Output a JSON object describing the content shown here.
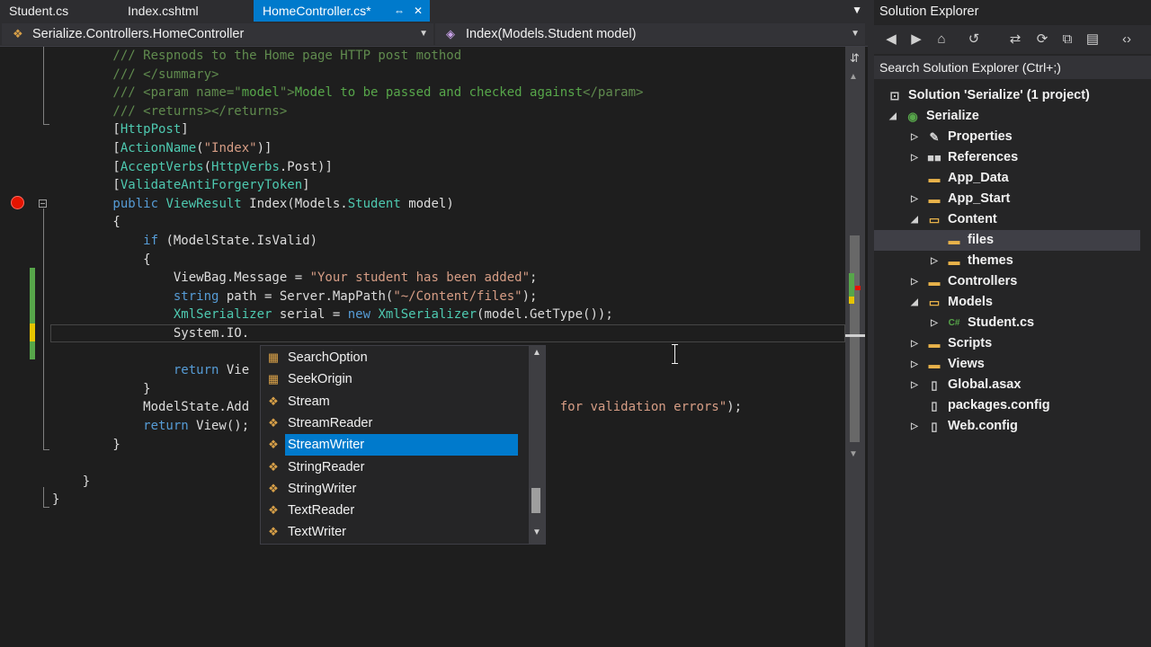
{
  "tabs": [
    {
      "label": "Student.cs"
    },
    {
      "label": "Index.cshtml"
    },
    {
      "label": "HomeController.cs*",
      "pin": "⇔",
      "close": "✕",
      "active": true
    }
  ],
  "navigation": {
    "type_dropdown": "Serialize.Controllers.HomeController",
    "member_dropdown": "Index(Models.Student model)"
  },
  "code_lines": [
    [
      {
        "c": "cmg",
        "t": "        /// Respnods to the Home page HTTP post mothod"
      }
    ],
    [
      {
        "c": "cmg",
        "t": "        /// </summary>"
      }
    ],
    [
      {
        "c": "cmg",
        "t": "        /// <param name=\""
      },
      {
        "c": "cm",
        "t": "model"
      },
      {
        "c": "cmg",
        "t": "\">"
      },
      {
        "c": "cm",
        "t": "Model to be passed and checked against"
      },
      {
        "c": "cmg",
        "t": "</param>"
      }
    ],
    [
      {
        "c": "cmg",
        "t": "        /// <returns></returns>"
      }
    ],
    [
      {
        "c": "pl",
        "t": "        ["
      },
      {
        "c": "ty",
        "t": "HttpPost"
      },
      {
        "c": "pl",
        "t": "]"
      }
    ],
    [
      {
        "c": "pl",
        "t": "        ["
      },
      {
        "c": "ty",
        "t": "ActionName"
      },
      {
        "c": "pl",
        "t": "("
      },
      {
        "c": "st",
        "t": "\"Index\""
      },
      {
        "c": "pl",
        "t": ")]"
      }
    ],
    [
      {
        "c": "pl",
        "t": "        ["
      },
      {
        "c": "ty",
        "t": "AcceptVerbs"
      },
      {
        "c": "pl",
        "t": "("
      },
      {
        "c": "ty",
        "t": "HttpVerbs"
      },
      {
        "c": "pl",
        "t": ".Post)]"
      }
    ],
    [
      {
        "c": "pl",
        "t": "        ["
      },
      {
        "c": "ty",
        "t": "ValidateAntiForgeryToken"
      },
      {
        "c": "pl",
        "t": "]"
      }
    ],
    [
      {
        "c": "kw",
        "t": "        public "
      },
      {
        "c": "ty",
        "t": "ViewResult"
      },
      {
        "c": "pl",
        "t": " Index(Models."
      },
      {
        "c": "ty",
        "t": "Student"
      },
      {
        "c": "pl",
        "t": " model)"
      }
    ],
    [
      {
        "c": "pl",
        "t": "        {"
      }
    ],
    [
      {
        "c": "kw",
        "t": "            if"
      },
      {
        "c": "pl",
        "t": " (ModelState.IsValid)"
      }
    ],
    [
      {
        "c": "pl",
        "t": "            {"
      }
    ],
    [
      {
        "c": "pl",
        "t": "                ViewBag.Message = "
      },
      {
        "c": "st",
        "t": "\"Your student has been added\""
      },
      {
        "c": "pl",
        "t": ";"
      }
    ],
    [
      {
        "c": "kw",
        "t": "                string"
      },
      {
        "c": "pl",
        "t": " path = Server.MapPath("
      },
      {
        "c": "st",
        "t": "\"~/Content/files\""
      },
      {
        "c": "pl",
        "t": ");"
      }
    ],
    [
      {
        "c": "ty",
        "t": "                XmlSerializer"
      },
      {
        "c": "pl",
        "t": " serial = "
      },
      {
        "c": "kw",
        "t": "new "
      },
      {
        "c": "ty",
        "t": "XmlSerializer"
      },
      {
        "c": "pl",
        "t": "(model.GetType());"
      }
    ],
    [
      {
        "c": "pl",
        "t": "                System.IO."
      }
    ],
    [
      {
        "c": "pl",
        "t": ""
      }
    ],
    [
      {
        "c": "kw",
        "t": "                return"
      },
      {
        "c": "pl",
        "t": " Vie"
      }
    ],
    [
      {
        "c": "pl",
        "t": "            }"
      }
    ],
    [
      {
        "c": "pl",
        "t": "            ModelState.Add"
      },
      {
        "c": "pl",
        "t": "                                         "
      },
      {
        "c": "st",
        "t": "for validation errors\""
      },
      {
        "c": "pl",
        "t": ");"
      }
    ],
    [
      {
        "c": "kw",
        "t": "            return"
      },
      {
        "c": "pl",
        "t": " View();"
      }
    ],
    [
      {
        "c": "pl",
        "t": "        }"
      }
    ],
    [
      {
        "c": "pl",
        "t": ""
      }
    ],
    [
      {
        "c": "pl",
        "t": "    }"
      }
    ],
    [
      {
        "c": "pl",
        "t": "}"
      }
    ]
  ],
  "intellisense": {
    "items": [
      {
        "label": "SearchOption",
        "icon": "enum-icon",
        "glyph": "▦"
      },
      {
        "label": "SeekOrigin",
        "icon": "enum-icon",
        "glyph": "▦"
      },
      {
        "label": "Stream",
        "icon": "class-icon",
        "glyph": "❖"
      },
      {
        "label": "StreamReader",
        "icon": "class-icon",
        "glyph": "❖"
      },
      {
        "label": "StreamWriter",
        "icon": "class-icon",
        "glyph": "❖",
        "selected": true
      },
      {
        "label": "StringReader",
        "icon": "class-icon",
        "glyph": "❖"
      },
      {
        "label": "StringWriter",
        "icon": "class-icon",
        "glyph": "❖"
      },
      {
        "label": "TextReader",
        "icon": "class-icon",
        "glyph": "❖"
      },
      {
        "label": "TextWriter",
        "icon": "class-icon",
        "glyph": "❖"
      }
    ]
  },
  "solution_explorer": {
    "title": "Solution Explorer",
    "search_placeholder": "Search Solution Explorer (Ctrl+;)",
    "toolbar": [
      {
        "name": "back-icon",
        "glyph": "◀"
      },
      {
        "name": "forward-icon",
        "glyph": "▶"
      },
      {
        "name": "home-icon",
        "glyph": "⌂"
      },
      {
        "name": "pending-changes-icon",
        "glyph": "↺"
      },
      {
        "name": "sync-icon",
        "glyph": "⇄"
      },
      {
        "name": "refresh-icon",
        "glyph": "⟳"
      },
      {
        "name": "collapse-all-icon",
        "glyph": "⧉"
      },
      {
        "name": "show-all-files-icon",
        "glyph": "▤"
      },
      {
        "name": "view-code-icon",
        "glyph": "‹›"
      }
    ],
    "tree": [
      {
        "label": "Solution 'Serialize' (1 project)",
        "level": 0,
        "arrow": "",
        "icon": "solution-icon",
        "glyph": "⊡",
        "color": "#c8c8c8"
      },
      {
        "label": "Serialize",
        "level": 1,
        "arrow": "◢",
        "icon": "project-icon",
        "glyph": "◉",
        "color": "#57a64a"
      },
      {
        "label": "Properties",
        "level": 2,
        "arrow": "▷",
        "icon": "wrench-icon",
        "glyph": "✎",
        "color": "#d0d0d0"
      },
      {
        "label": "References",
        "level": 2,
        "arrow": "▷",
        "icon": "references-icon",
        "glyph": "■■",
        "color": "#d0d0d0"
      },
      {
        "label": "App_Data",
        "level": 2,
        "arrow": "",
        "icon": "folder-icon",
        "glyph": "▬",
        "color": "#e8b24a"
      },
      {
        "label": "App_Start",
        "level": 2,
        "arrow": "▷",
        "icon": "folder-icon",
        "glyph": "▬",
        "color": "#e8b24a"
      },
      {
        "label": "Content",
        "level": 2,
        "arrow": "◢",
        "icon": "folder-open-icon",
        "glyph": "▭",
        "color": "#e8b24a"
      },
      {
        "label": "files",
        "level": 3,
        "arrow": "",
        "icon": "folder-icon",
        "glyph": "▬",
        "color": "#e8b24a",
        "selected": true
      },
      {
        "label": "themes",
        "level": 3,
        "arrow": "▷",
        "icon": "folder-icon",
        "glyph": "▬",
        "color": "#e8b24a"
      },
      {
        "label": "Controllers",
        "level": 2,
        "arrow": "▷",
        "icon": "folder-icon",
        "glyph": "▬",
        "color": "#e8b24a"
      },
      {
        "label": "Models",
        "level": 2,
        "arrow": "◢",
        "icon": "folder-open-icon",
        "glyph": "▭",
        "color": "#e8b24a"
      },
      {
        "label": "Student.cs",
        "level": 3,
        "arrow": "▷",
        "icon": "csharp-file-icon",
        "glyph": "C#",
        "color": "#57a64a"
      },
      {
        "label": "Scripts",
        "level": 2,
        "arrow": "▷",
        "icon": "folder-icon",
        "glyph": "▬",
        "color": "#e8b24a"
      },
      {
        "label": "Views",
        "level": 2,
        "arrow": "▷",
        "icon": "folder-icon",
        "glyph": "▬",
        "color": "#e8b24a"
      },
      {
        "label": "Global.asax",
        "level": 2,
        "arrow": "▷",
        "icon": "file-icon",
        "glyph": "▯",
        "color": "#d0d0d0"
      },
      {
        "label": "packages.config",
        "level": 2,
        "arrow": "",
        "icon": "config-file-icon",
        "glyph": "▯",
        "color": "#d0d0d0"
      },
      {
        "label": "Web.config",
        "level": 2,
        "arrow": "▷",
        "icon": "config-file-icon",
        "glyph": "▯",
        "color": "#d0d0d0"
      }
    ]
  },
  "colors": {
    "accent": "#007acc",
    "breakpoint": "#e51400",
    "change_saved": "#57a64a",
    "change_unsaved": "#e5c400"
  }
}
